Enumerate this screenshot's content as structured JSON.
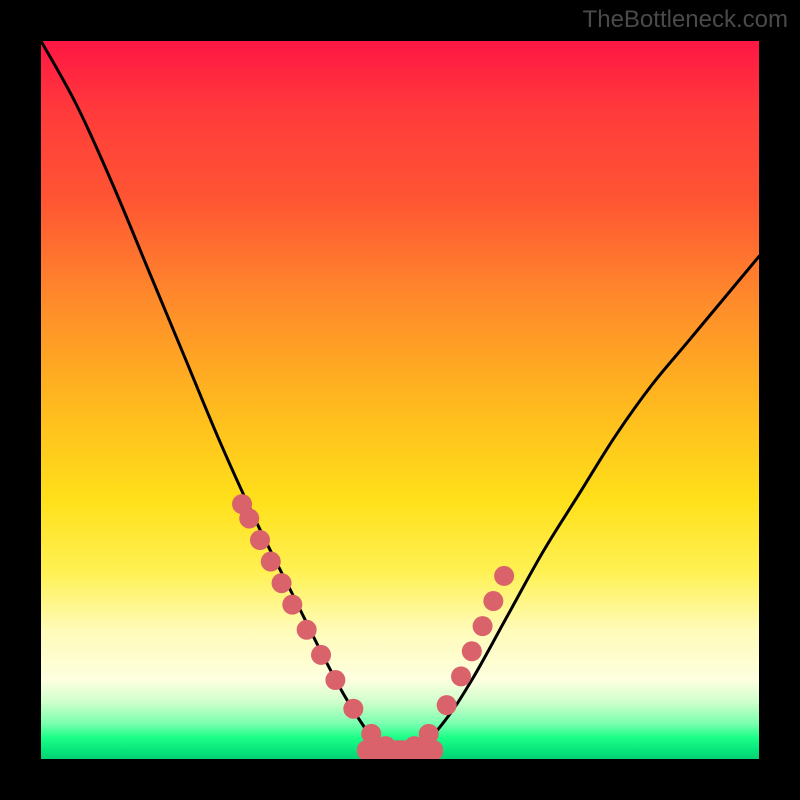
{
  "watermark": "TheBottleneck.com",
  "chart_data": {
    "type": "line",
    "title": "",
    "xlabel": "",
    "ylabel": "",
    "xlim": [
      0,
      1
    ],
    "ylim": [
      0,
      1
    ],
    "series": [
      {
        "name": "bottleneck-curve",
        "x": [
          0.0,
          0.05,
          0.1,
          0.15,
          0.2,
          0.25,
          0.3,
          0.35,
          0.4,
          0.44,
          0.48,
          0.52,
          0.56,
          0.6,
          0.65,
          0.7,
          0.75,
          0.8,
          0.85,
          0.9,
          0.95,
          1.0
        ],
        "y": [
          1.0,
          0.91,
          0.8,
          0.68,
          0.56,
          0.44,
          0.33,
          0.23,
          0.13,
          0.06,
          0.01,
          0.01,
          0.05,
          0.11,
          0.2,
          0.29,
          0.37,
          0.45,
          0.52,
          0.58,
          0.64,
          0.7
        ]
      }
    ],
    "markers": {
      "name": "highlight-dots",
      "x": [
        0.28,
        0.29,
        0.305,
        0.32,
        0.335,
        0.35,
        0.37,
        0.39,
        0.41,
        0.435,
        0.46,
        0.48,
        0.5,
        0.52,
        0.54,
        0.565,
        0.585,
        0.6,
        0.615,
        0.63,
        0.645
      ],
      "y": [
        0.355,
        0.335,
        0.305,
        0.275,
        0.245,
        0.215,
        0.18,
        0.145,
        0.11,
        0.07,
        0.035,
        0.018,
        0.012,
        0.018,
        0.035,
        0.075,
        0.115,
        0.15,
        0.185,
        0.22,
        0.255
      ]
    },
    "plateau": {
      "xrange": [
        0.44,
        0.56
      ],
      "y": 0.012,
      "thickness": 0.028
    }
  }
}
